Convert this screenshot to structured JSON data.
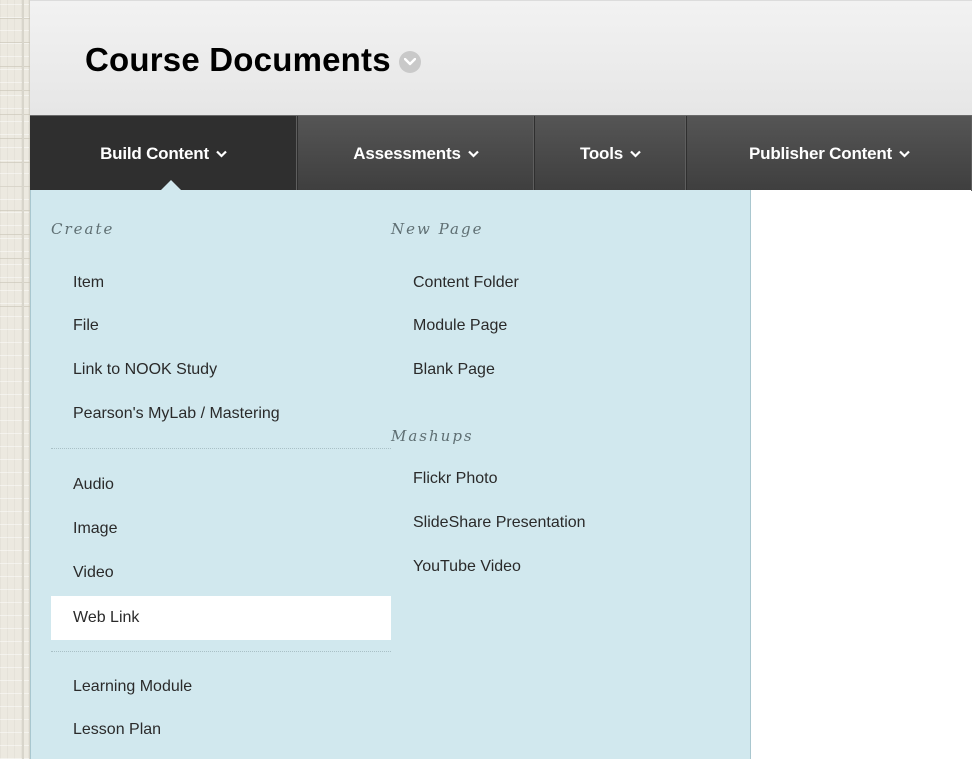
{
  "page": {
    "title": "Course Documents"
  },
  "tabs": [
    {
      "label": "Build Content",
      "active": true
    },
    {
      "label": "Assessments",
      "active": false
    },
    {
      "label": "Tools",
      "active": false
    },
    {
      "label": "Publisher Content",
      "active": false
    }
  ],
  "menu": {
    "create": {
      "heading": "Create",
      "group1": [
        "Item",
        "File",
        "Link to NOOK Study",
        "Pearson's MyLab / Mastering"
      ],
      "group2": [
        "Audio",
        "Image",
        "Video",
        "Web Link"
      ],
      "group3": [
        "Learning Module",
        "Lesson Plan"
      ],
      "selected_item": "Web Link"
    },
    "new_page": {
      "heading": "New Page",
      "items": [
        "Content Folder",
        "Module Page",
        "Blank Page"
      ]
    },
    "mashups": {
      "heading": "Mashups",
      "items": [
        "Flickr Photo",
        "SlideShare Presentation",
        "YouTube Video"
      ]
    }
  },
  "colors": {
    "tabbar": "#444444",
    "active_tab": "#2f2f2f",
    "dropdown_bg": "#d1e8ee",
    "selected_bg": "#ffffff"
  },
  "icons": {
    "title_menu": "chevron-down-circle-icon",
    "tab_menu": "chevron-down-icon"
  }
}
